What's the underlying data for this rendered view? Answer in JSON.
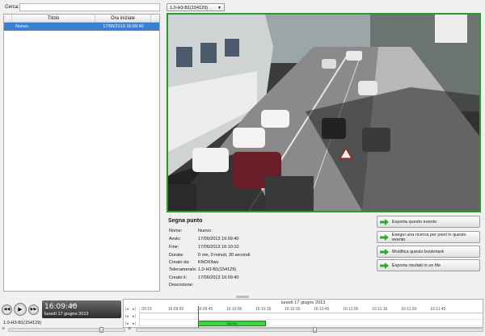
{
  "search": {
    "label": "Cerca:",
    "value": ""
  },
  "bookmarks": {
    "columns": [
      "Titolo",
      "Ora iniziale"
    ],
    "rows": [
      {
        "title": "Nuovo",
        "time": "17/06/2013 16:09:40",
        "selected": true
      }
    ]
  },
  "camera_select": {
    "value": "1.0-H3-B1(154129)"
  },
  "video": {
    "scene": "street-camera-view"
  },
  "details": {
    "title": "Segna punto",
    "fields": [
      {
        "key": "Nome:",
        "value": "Nuovo"
      },
      {
        "key": "Avvio:",
        "value": "17/06/2013 16:09:40"
      },
      {
        "key": "Fine:",
        "value": "17/06/2013 16:10:10"
      },
      {
        "key": "Durata:",
        "value": "0 ore, 0 minuti, 30 secondi"
      },
      {
        "key": "Creato da:",
        "value": "KNOX\\lwu"
      },
      {
        "key": "Telecamera/e:",
        "value": "1.0-H3-B1(154129)"
      },
      {
        "key": "Creato il:",
        "value": "17/06/2013 16:09:40"
      },
      {
        "key": "Descrizione:",
        "value": ""
      }
    ]
  },
  "actions": [
    {
      "label": "Esporta questo evento"
    },
    {
      "label": "Esegui una ricerca per pixel in questo evento"
    },
    {
      "label": "Modifica questo bookmark"
    },
    {
      "label": "Esporta risultati in un file"
    }
  ],
  "playback": {
    "time": "16:09:40",
    "ms": "480",
    "date": "lunedì 17 giugno 2013",
    "camera_label": "1.0-H3-B1(154129)"
  },
  "timeline": {
    "date": "lunedì 17 giugno 2013",
    "ticks": [
      "09:15",
      "16:09:30",
      "16:09:45",
      "16:10:00",
      "16:10:15",
      "16:10:30",
      "16:10:45",
      "16:11:00",
      "16:11:15",
      "16:11:30",
      "16:11:45"
    ],
    "event_label": "Nuovo"
  },
  "colors": {
    "selection": "#3a7fd0",
    "video_border": "#2b9a2b",
    "event_bar": "#3fd43f",
    "playhead": "#e02020",
    "arrow": "#2fa82f"
  }
}
